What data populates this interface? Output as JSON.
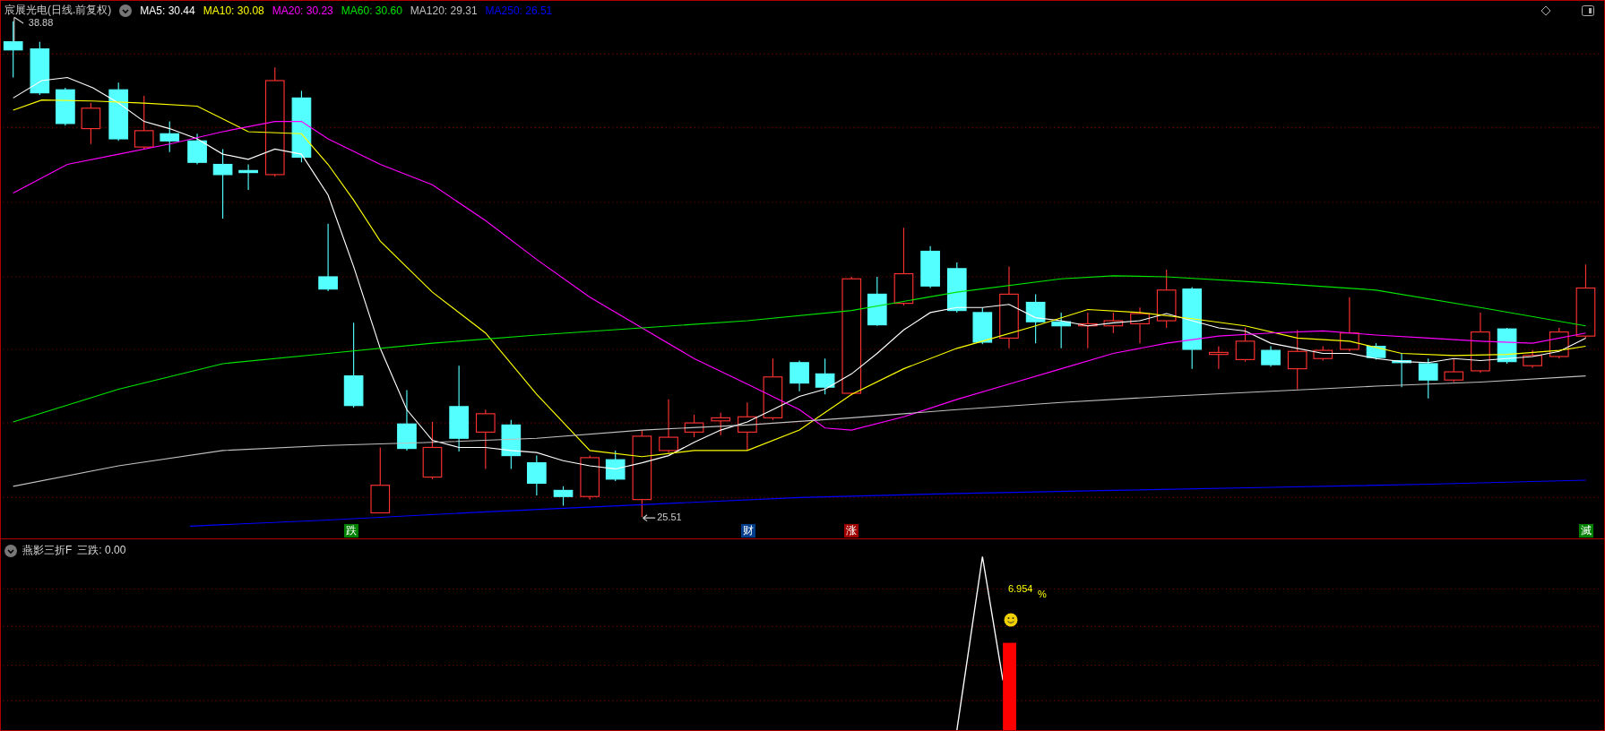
{
  "chart_header": {
    "title": "宸展光电(日线.前复权)",
    "ma_legend": [
      {
        "label": "MA5: 30.44",
        "color": "#ffffff"
      },
      {
        "label": "MA10: 30.08",
        "color": "#ffff00"
      },
      {
        "label": "MA20: 30.23",
        "color": "#ff00ff"
      },
      {
        "label": "MA60: 30.60",
        "color": "#00e600"
      },
      {
        "label": "MA120: 29.31",
        "color": "#c0c0c0"
      },
      {
        "label": "MA250: 26.51",
        "color": "#0000ff"
      }
    ]
  },
  "price_labels": {
    "high": "38.88",
    "low": "25.51"
  },
  "signal_markers": [
    {
      "text": "跌",
      "color": "#008000"
    },
    {
      "text": "财",
      "color": "#003c8c"
    },
    {
      "text": "涨",
      "color": "#a00000"
    },
    {
      "text": "滅",
      "color": "#008000"
    }
  ],
  "indicator": {
    "title": "燕影三折F",
    "value": "三跌: 0.00",
    "reading": "6.954",
    "unit": "%"
  }
}
